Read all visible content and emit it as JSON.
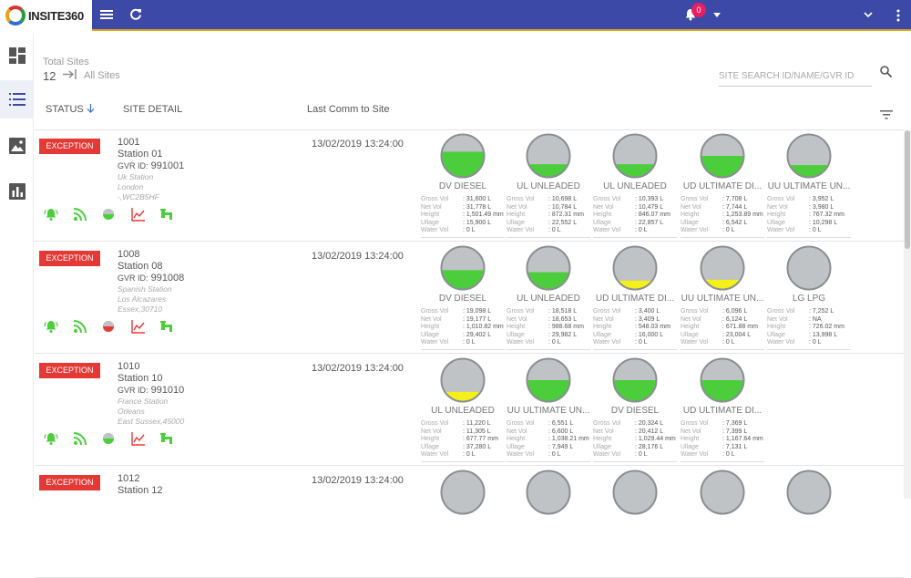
{
  "app": {
    "logo_text": "INSITE360",
    "notification_count": "0"
  },
  "header": {
    "total_sites_label": "Total Sites",
    "total_sites_count": "12",
    "all_sites_label": "All Sites",
    "search_placeholder": "SITE SEARCH ID/NAME/GVR ID"
  },
  "columns": {
    "status": "STATUS",
    "site_detail": "SITE DETAIL",
    "last_comm": "Last Comm to Site"
  },
  "tank_labels": {
    "gross": "Gross Vol",
    "net": "Net Vol",
    "height": "Height",
    "ullage": "Ullage",
    "water": "Water Vol"
  },
  "colors": {
    "topbar": "#3d49a6",
    "exception": "#e53935",
    "ok_green": "#4ccd3c",
    "low_yellow": "#f5ef1a",
    "tank_grey": "#bfc3c6"
  },
  "sites": [
    {
      "status": "EXCEPTION",
      "id": "1001",
      "name": "Station 01",
      "gvr_label": "GVR ID:",
      "gvr": "991001",
      "address": [
        "Uk Station",
        "London",
        "-,WC2B5HF"
      ],
      "last_comm": "13/02/2019 13:24:00",
      "conn_color": "#4ccd3c",
      "tanks": [
        {
          "name": "DV DIESEL",
          "level": 0.6,
          "color": "#4ccd3c",
          "gross": ": 31,600 L",
          "net": ": 31,778 L",
          "height": ": 1,501.49 mm",
          "ullage": ": 15,900 L",
          "water": ": 0 L"
        },
        {
          "name": "UL UNLEADED",
          "level": 0.3,
          "color": "#4ccd3c",
          "gross": ": 10,698 L",
          "net": ": 10,784 L",
          "height": ": 872.31 mm",
          "ullage": ": 22,552 L",
          "water": ": 0 L"
        },
        {
          "name": "UL UNLEADED",
          "level": 0.3,
          "color": "#4ccd3c",
          "gross": ": 10,393 L",
          "net": ": 10,479 L",
          "height": ": 846.07 mm",
          "ullage": ": 22,857 L",
          "water": ": 0 L"
        },
        {
          "name": "UD ULTIMATE DI...",
          "level": 0.5,
          "color": "#4ccd3c",
          "gross": ": 7,708 L",
          "net": ": 7,744 L",
          "height": ": 1,253.89 mm",
          "ullage": ": 6,542 L",
          "water": ": 0 L"
        },
        {
          "name": "UU ULTIMATE UN...",
          "level": 0.28,
          "color": "#4ccd3c",
          "gross": ": 3,952 L",
          "net": ": 3,980 L",
          "height": ": 767.32 mm",
          "ullage": ": 10,298 L",
          "water": ": 0 L"
        }
      ]
    },
    {
      "status": "EXCEPTION",
      "id": "1008",
      "name": "Station 08",
      "gvr_label": "GVR ID:",
      "gvr": "991008",
      "address": [
        "Spanish Station",
        "Los Alcazares",
        "Essex,30710"
      ],
      "last_comm": "13/02/2019 13:24:00",
      "conn_color": "#e53935",
      "tanks": [
        {
          "name": "DV DIESEL",
          "level": 0.45,
          "color": "#4ccd3c",
          "gross": ": 19,098 L",
          "net": ": 19,177 L",
          "height": ": 1,010.82 mm",
          "ullage": ": 29,402 L",
          "water": ": 0 L"
        },
        {
          "name": "UL UNLEADED",
          "level": 0.4,
          "color": "#4ccd3c",
          "gross": ": 18,518 L",
          "net": ": 18,653 L",
          "height": ": 988.68 mm",
          "ullage": ": 29,982 L",
          "water": ": 0 L"
        },
        {
          "name": "UD ULTIMATE DI...",
          "level": 0.2,
          "color": "#f5ef1a",
          "gross": ": 3,400 L",
          "net": ": 3,409 L",
          "height": ": 548.03 mm",
          "ullage": ": 16,000 L",
          "water": ": 0 L"
        },
        {
          "name": "UU ULTIMATE UN...",
          "level": 0.22,
          "color": "#f5ef1a",
          "gross": ": 6,096 L",
          "net": ": 6,124 L",
          "height": ": 671.88 mm",
          "ullage": ": 23,004 L",
          "water": ": 0 L"
        },
        {
          "name": "LG LPG",
          "level": 0,
          "color": "#4ccd3c",
          "gross": ": 7,252 L",
          "net": ": NA",
          "height": ": 726.02 mm",
          "ullage": ": 13,998 L",
          "water": ": 0 L"
        }
      ]
    },
    {
      "status": "EXCEPTION",
      "id": "1010",
      "name": "Station 10",
      "gvr_label": "GVR ID:",
      "gvr": "991010",
      "address": [
        "France Station",
        "Orleans",
        "East Sussex,45000"
      ],
      "last_comm": "13/02/2019 13:24:00",
      "conn_color": "#4ccd3c",
      "tanks": [
        {
          "name": "UL UNLEADED",
          "level": 0.22,
          "color": "#f5ef1a",
          "gross": ": 11,220 L",
          "net": ": 11,305 L",
          "height": ": 677.77 mm",
          "ullage": ": 37,280 L",
          "water": ": 0 L"
        },
        {
          "name": "UU ULTIMATE UN...",
          "level": 0.5,
          "color": "#4ccd3c",
          "gross": ": 6,551 L",
          "net": ": 6,600 L",
          "height": ": 1,038.21 mm",
          "ullage": ": 7,949 L",
          "water": ": 0 L"
        },
        {
          "name": "DV DIESEL",
          "level": 0.5,
          "color": "#4ccd3c",
          "gross": ": 20,324 L",
          "net": ": 20,412 L",
          "height": ": 1,029.44 mm",
          "ullage": ": 28,176 L",
          "water": ": 0 L"
        },
        {
          "name": "UD ULTIMATE DI...",
          "level": 0.5,
          "color": "#4ccd3c",
          "gross": ": 7,369 L",
          "net": ": 7,399 L",
          "height": ": 1,167.64 mm",
          "ullage": ": 7,131 L",
          "water": ": 0 L"
        }
      ]
    },
    {
      "status": "EXCEPTION",
      "id": "1012",
      "name": "Station 12",
      "gvr_label": "",
      "gvr": "",
      "address": [],
      "last_comm": "13/02/2019 13:24:00",
      "conn_color": "#4ccd3c",
      "tanks": [
        {
          "name": "",
          "level": 0,
          "color": "#4ccd3c",
          "gross": "",
          "net": "",
          "height": "",
          "ullage": "",
          "water": ""
        },
        {
          "name": "",
          "level": 0,
          "color": "#4ccd3c",
          "gross": "",
          "net": "",
          "height": "",
          "ullage": "",
          "water": ""
        },
        {
          "name": "",
          "level": 0,
          "color": "#4ccd3c",
          "gross": "",
          "net": "",
          "height": "",
          "ullage": "",
          "water": ""
        },
        {
          "name": "",
          "level": 0,
          "color": "#4ccd3c",
          "gross": "",
          "net": "",
          "height": "",
          "ullage": "",
          "water": ""
        },
        {
          "name": "",
          "level": 0,
          "color": "#4ccd3c",
          "gross": "",
          "net": "",
          "height": "",
          "ullage": "",
          "water": ""
        }
      ]
    }
  ]
}
